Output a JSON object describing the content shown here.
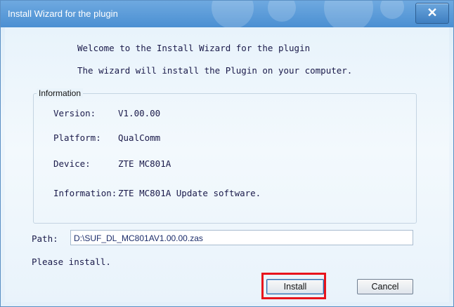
{
  "window": {
    "title": "Install Wizard for the plugin",
    "close_glyph": "✕"
  },
  "welcome": {
    "line1": "Welcome to the Install Wizard for the plugin",
    "line2": "The wizard will install the Plugin on your computer."
  },
  "information": {
    "legend": "Information",
    "rows": [
      {
        "label": "Version:",
        "value": "V1.00.00"
      },
      {
        "label": "Platform:",
        "value": "QualComm"
      },
      {
        "label": "Device:",
        "value": "ZTE MC801A"
      },
      {
        "label": "Information:",
        "value": "ZTE MC801A Update software."
      }
    ]
  },
  "path": {
    "label": "Path:",
    "value": "D:\\SUF_DL_MC801AV1.00.00.zas"
  },
  "status_text": "Please install.",
  "buttons": {
    "install_label": "Install",
    "cancel_label": "Cancel"
  },
  "colors": {
    "highlight": "#e8141c",
    "titlebar": "#4b8fd2"
  }
}
